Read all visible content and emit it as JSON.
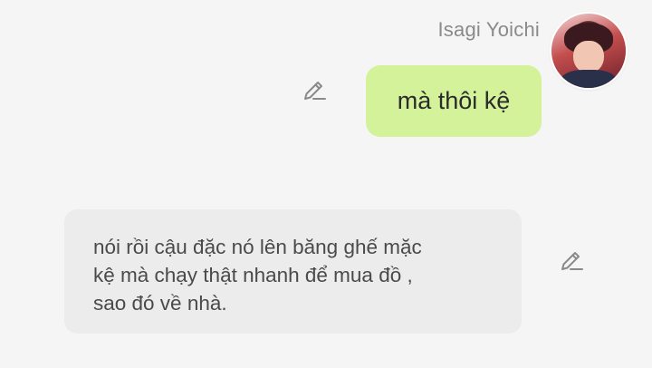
{
  "sender": {
    "name": "Isagi Yoichi"
  },
  "messages": [
    {
      "side": "right",
      "text": "mà thôi kệ"
    },
    {
      "side": "left",
      "text": "nói rồi cậu đặc nó lên băng ghế mặc\nkệ mà chạy thật nhanh để mua đồ ,\nsao đó về nhà."
    }
  ],
  "icons": {
    "edit": "pencil-edit-icon",
    "avatar": "avatar"
  },
  "colors": {
    "background": "#f5f5f5",
    "right_bubble": "#d3f29a",
    "left_bubble": "#ececec",
    "name_text": "#8a8a8a"
  }
}
